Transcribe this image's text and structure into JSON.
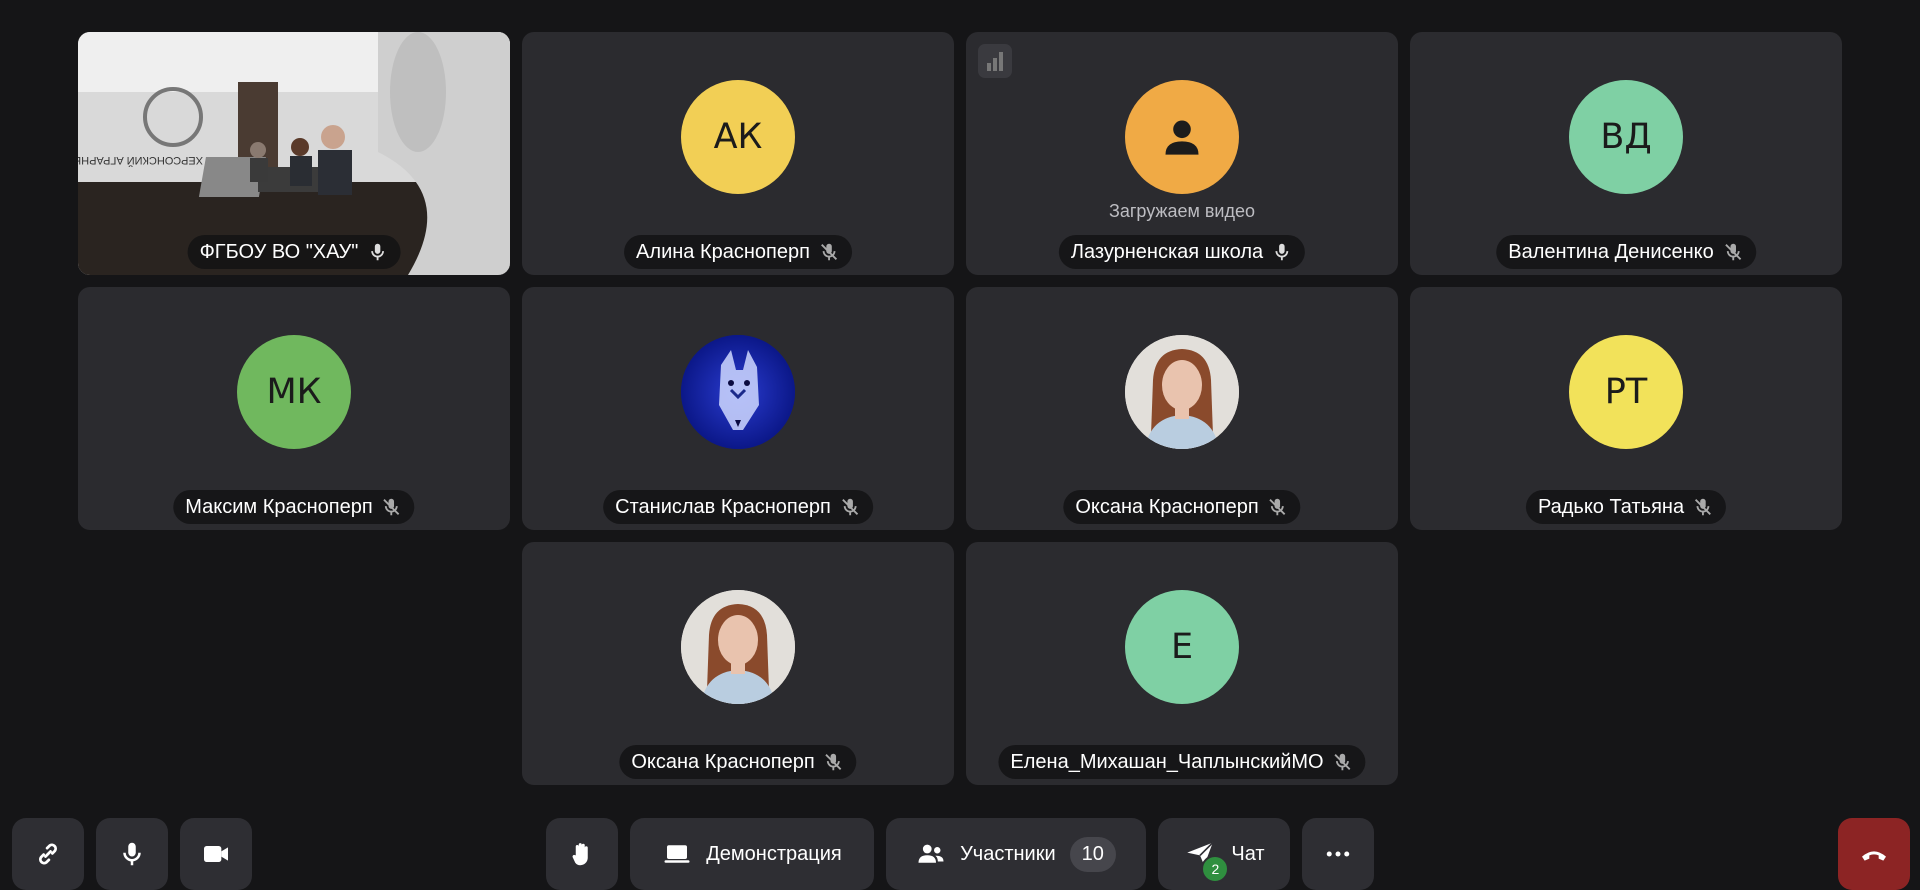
{
  "tiles": [
    {
      "name": "ФГБОУ ВО \"ХАУ\"",
      "type": "video",
      "mic": "on",
      "scene_text": "ХЕРСОНСКИЙ АГРАРНЫЙ"
    },
    {
      "name": "Алина Красноперп",
      "initials": "АК",
      "color": "#f2cf55",
      "mic": "off"
    },
    {
      "name": "Лазурненская школа",
      "type": "loading",
      "loading_text": "Загружаем видео",
      "mic": "on",
      "color": "#f0aa45",
      "icon": "person-icon"
    },
    {
      "name": "Валентина Денисенко",
      "initials": "ВД",
      "color": "#7fd0a4",
      "mic": "off"
    },
    {
      "name": "Максим Красноперп",
      "initials": "МК",
      "color": "#70b85e",
      "mic": "off"
    },
    {
      "name": "Станислав Красноперп",
      "type": "photo-wolf",
      "mic": "off"
    },
    {
      "name": "Оксана Красноперп",
      "type": "photo-woman",
      "mic": "off"
    },
    {
      "name": "Радько Татьяна",
      "initials": "РТ",
      "color": "#f2e25a",
      "mic": "off"
    },
    {
      "name": "Оксана Красноперп",
      "type": "photo-woman",
      "mic": "off"
    },
    {
      "name": "Елена_Михашан_ЧаплынскийМО",
      "initials": "Е",
      "color": "#7fd0a4",
      "mic": "off"
    }
  ],
  "controls": {
    "link_icon": "link-icon",
    "mic_icon": "microphone-icon",
    "camera_icon": "camera-icon",
    "hand_icon": "raise-hand-icon",
    "demo_label": "Демонстрация",
    "participants_label": "Участники",
    "participants_count": "10",
    "chat_label": "Чат",
    "chat_badge": "2",
    "more_icon": "more-icon",
    "hangup_icon": "hangup-icon"
  },
  "colors": {
    "background": "#151517",
    "tile": "#2b2b2f",
    "control": "#2e2e33",
    "hangup": "#8c2424"
  }
}
